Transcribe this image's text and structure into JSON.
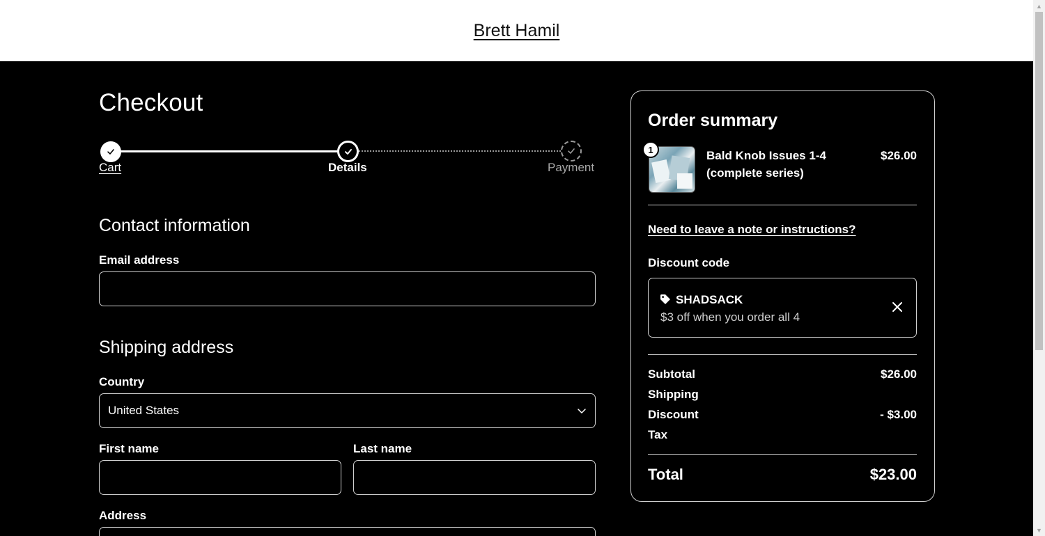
{
  "header": {
    "store_name": "Brett Hamil"
  },
  "checkout": {
    "title": "Checkout",
    "steps": [
      {
        "label": "Cart",
        "state": "complete"
      },
      {
        "label": "Details",
        "state": "current"
      },
      {
        "label": "Payment",
        "state": "upcoming"
      }
    ]
  },
  "contact": {
    "title": "Contact information",
    "email_label": "Email address",
    "email_value": ""
  },
  "shipping": {
    "title": "Shipping address",
    "country_label": "Country",
    "country_value": "United States",
    "first_name_label": "First name",
    "first_name_value": "",
    "last_name_label": "Last name",
    "last_name_value": "",
    "address_label": "Address"
  },
  "summary": {
    "title": "Order summary",
    "item": {
      "quantity": "1",
      "name": "Bald Knob Issues 1-4 (complete series)",
      "price": "$26.00"
    },
    "note_link": "Need to leave a note or instructions?",
    "discount_label": "Discount code",
    "discount": {
      "code": "SHADSACK",
      "description": "$3 off when you order all 4"
    },
    "rows": {
      "subtotal_label": "Subtotal",
      "subtotal_value": "$26.00",
      "shipping_label": "Shipping",
      "shipping_value": "",
      "discount_label": "Discount",
      "discount_value": "- $3.00",
      "tax_label": "Tax",
      "tax_value": "",
      "total_label": "Total",
      "total_value": "$23.00"
    }
  },
  "colors": {
    "background": "#000000",
    "foreground": "#ffffff",
    "border": "#d0d0d0",
    "muted": "#a9a9a9"
  },
  "icons": {
    "step_complete": "check-icon",
    "tag": "tag-icon",
    "remove": "close-icon",
    "select": "chevron-down-icon"
  }
}
